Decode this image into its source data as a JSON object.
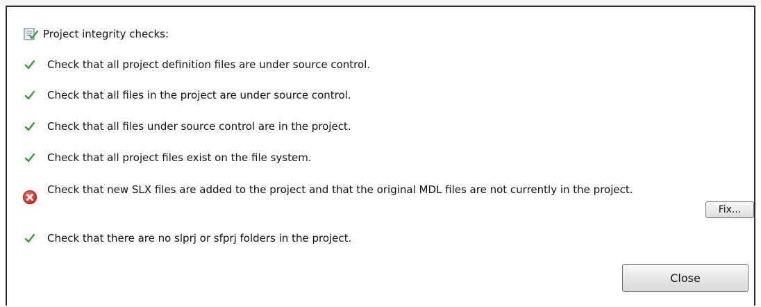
{
  "header": {
    "title": "Project integrity checks:",
    "icon": "checklist-icon"
  },
  "checks": [
    {
      "text": "Check that all project definition files are under source control.",
      "status": "pass",
      "icon": "green-checkmark-icon"
    },
    {
      "text": "Check that all files in the project are under source control.",
      "status": "pass",
      "icon": "green-checkmark-icon"
    },
    {
      "text": "Check that all files under source control are in the project.",
      "status": "pass",
      "icon": "green-checkmark-icon"
    },
    {
      "text": "Check that all project files exist on the file system.",
      "status": "pass",
      "icon": "green-checkmark-icon"
    },
    {
      "text": "Check that new SLX files are added to the project and that the original MDL files are not currently in the project.",
      "status": "fail",
      "icon": "red-error-icon"
    },
    {
      "text": "Check that there are no slprj or sfprj folders in the project.",
      "status": "pass",
      "icon": "green-checkmark-icon"
    }
  ],
  "buttons": {
    "fix_label": "Fix...",
    "close_label": "Close"
  },
  "colors": {
    "pass": "#2e9e2e",
    "fail": "#d23a2a",
    "border": "#2b2b2b"
  }
}
